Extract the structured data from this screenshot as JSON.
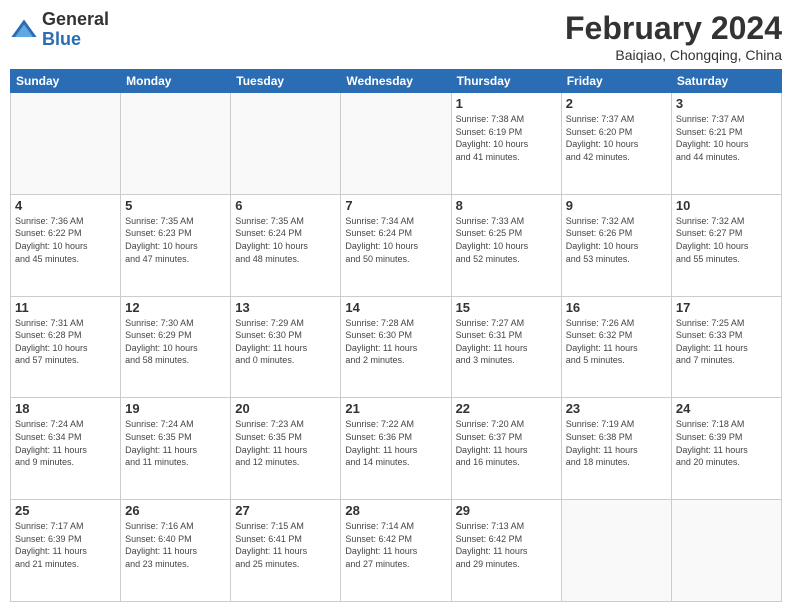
{
  "logo": {
    "general": "General",
    "blue": "Blue"
  },
  "header": {
    "month_year": "February 2024",
    "location": "Baiqiao, Chongqing, China"
  },
  "weekdays": [
    "Sunday",
    "Monday",
    "Tuesday",
    "Wednesday",
    "Thursday",
    "Friday",
    "Saturday"
  ],
  "weeks": [
    [
      {
        "day": "",
        "info": "",
        "empty": true
      },
      {
        "day": "",
        "info": "",
        "empty": true
      },
      {
        "day": "",
        "info": "",
        "empty": true
      },
      {
        "day": "",
        "info": "",
        "empty": true
      },
      {
        "day": "1",
        "info": "Sunrise: 7:38 AM\nSunset: 6:19 PM\nDaylight: 10 hours\nand 41 minutes."
      },
      {
        "day": "2",
        "info": "Sunrise: 7:37 AM\nSunset: 6:20 PM\nDaylight: 10 hours\nand 42 minutes."
      },
      {
        "day": "3",
        "info": "Sunrise: 7:37 AM\nSunset: 6:21 PM\nDaylight: 10 hours\nand 44 minutes."
      }
    ],
    [
      {
        "day": "4",
        "info": "Sunrise: 7:36 AM\nSunset: 6:22 PM\nDaylight: 10 hours\nand 45 minutes."
      },
      {
        "day": "5",
        "info": "Sunrise: 7:35 AM\nSunset: 6:23 PM\nDaylight: 10 hours\nand 47 minutes."
      },
      {
        "day": "6",
        "info": "Sunrise: 7:35 AM\nSunset: 6:24 PM\nDaylight: 10 hours\nand 48 minutes."
      },
      {
        "day": "7",
        "info": "Sunrise: 7:34 AM\nSunset: 6:24 PM\nDaylight: 10 hours\nand 50 minutes."
      },
      {
        "day": "8",
        "info": "Sunrise: 7:33 AM\nSunset: 6:25 PM\nDaylight: 10 hours\nand 52 minutes."
      },
      {
        "day": "9",
        "info": "Sunrise: 7:32 AM\nSunset: 6:26 PM\nDaylight: 10 hours\nand 53 minutes."
      },
      {
        "day": "10",
        "info": "Sunrise: 7:32 AM\nSunset: 6:27 PM\nDaylight: 10 hours\nand 55 minutes."
      }
    ],
    [
      {
        "day": "11",
        "info": "Sunrise: 7:31 AM\nSunset: 6:28 PM\nDaylight: 10 hours\nand 57 minutes."
      },
      {
        "day": "12",
        "info": "Sunrise: 7:30 AM\nSunset: 6:29 PM\nDaylight: 10 hours\nand 58 minutes."
      },
      {
        "day": "13",
        "info": "Sunrise: 7:29 AM\nSunset: 6:30 PM\nDaylight: 11 hours\nand 0 minutes."
      },
      {
        "day": "14",
        "info": "Sunrise: 7:28 AM\nSunset: 6:30 PM\nDaylight: 11 hours\nand 2 minutes."
      },
      {
        "day": "15",
        "info": "Sunrise: 7:27 AM\nSunset: 6:31 PM\nDaylight: 11 hours\nand 3 minutes."
      },
      {
        "day": "16",
        "info": "Sunrise: 7:26 AM\nSunset: 6:32 PM\nDaylight: 11 hours\nand 5 minutes."
      },
      {
        "day": "17",
        "info": "Sunrise: 7:25 AM\nSunset: 6:33 PM\nDaylight: 11 hours\nand 7 minutes."
      }
    ],
    [
      {
        "day": "18",
        "info": "Sunrise: 7:24 AM\nSunset: 6:34 PM\nDaylight: 11 hours\nand 9 minutes."
      },
      {
        "day": "19",
        "info": "Sunrise: 7:24 AM\nSunset: 6:35 PM\nDaylight: 11 hours\nand 11 minutes."
      },
      {
        "day": "20",
        "info": "Sunrise: 7:23 AM\nSunset: 6:35 PM\nDaylight: 11 hours\nand 12 minutes."
      },
      {
        "day": "21",
        "info": "Sunrise: 7:22 AM\nSunset: 6:36 PM\nDaylight: 11 hours\nand 14 minutes."
      },
      {
        "day": "22",
        "info": "Sunrise: 7:20 AM\nSunset: 6:37 PM\nDaylight: 11 hours\nand 16 minutes."
      },
      {
        "day": "23",
        "info": "Sunrise: 7:19 AM\nSunset: 6:38 PM\nDaylight: 11 hours\nand 18 minutes."
      },
      {
        "day": "24",
        "info": "Sunrise: 7:18 AM\nSunset: 6:39 PM\nDaylight: 11 hours\nand 20 minutes."
      }
    ],
    [
      {
        "day": "25",
        "info": "Sunrise: 7:17 AM\nSunset: 6:39 PM\nDaylight: 11 hours\nand 21 minutes."
      },
      {
        "day": "26",
        "info": "Sunrise: 7:16 AM\nSunset: 6:40 PM\nDaylight: 11 hours\nand 23 minutes."
      },
      {
        "day": "27",
        "info": "Sunrise: 7:15 AM\nSunset: 6:41 PM\nDaylight: 11 hours\nand 25 minutes."
      },
      {
        "day": "28",
        "info": "Sunrise: 7:14 AM\nSunset: 6:42 PM\nDaylight: 11 hours\nand 27 minutes."
      },
      {
        "day": "29",
        "info": "Sunrise: 7:13 AM\nSunset: 6:42 PM\nDaylight: 11 hours\nand 29 minutes."
      },
      {
        "day": "",
        "info": "",
        "empty": true
      },
      {
        "day": "",
        "info": "",
        "empty": true
      }
    ]
  ]
}
